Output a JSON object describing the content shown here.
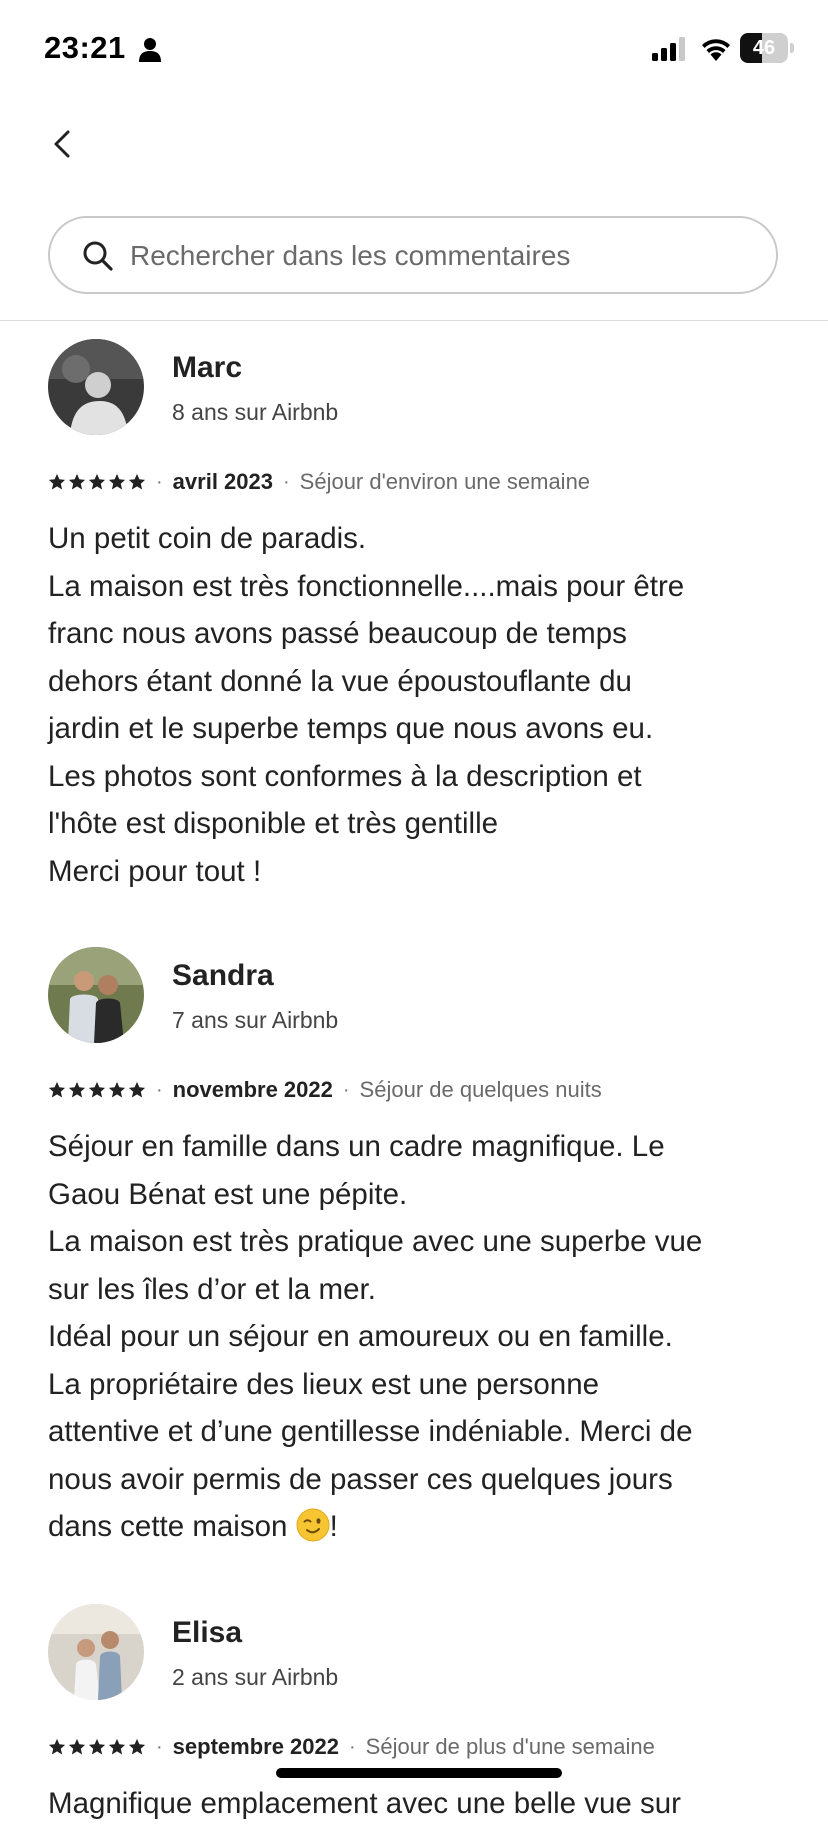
{
  "status_bar": {
    "time": "23:21",
    "battery": "46",
    "battery_level": 0.46
  },
  "search": {
    "placeholder": "Rechercher dans les commentaires"
  },
  "reviews": [
    {
      "name": "Marc",
      "tenure": "8 ans sur Airbnb",
      "rating": 5,
      "date": "avril 2023",
      "stay": "Séjour d'environ une semaine",
      "lines": [
        "Un petit coin de paradis.",
        "La maison est très fonctionnelle....mais pour être",
        "franc nous avons passé beaucoup de temps",
        "dehors étant donné la vue époustouflante du",
        "jardin et le superbe temps que nous avons eu.",
        "Les photos sont conformes à la description et",
        "l'hôte est disponible et très gentille",
        "Merci pour tout !"
      ]
    },
    {
      "name": "Sandra",
      "tenure": "7 ans sur Airbnb",
      "rating": 5,
      "date": "novembre 2022",
      "stay": "Séjour de quelques nuits",
      "lines": [
        "Séjour en famille dans un cadre magnifique. Le",
        "Gaou Bénat est une pépite.",
        "La maison est très pratique avec une superbe vue",
        "sur les îles d’or et la mer.",
        "Idéal pour un séjour en amoureux ou en famille.",
        "La propriétaire des lieux est une personne",
        "attentive et d’une gentillesse indéniable. Merci de",
        "nous avoir permis de passer ces quelques jours",
        "dans cette maison",
        "!"
      ]
    },
    {
      "name": "Elisa",
      "tenure": "2 ans sur Airbnb",
      "rating": 5,
      "date": "septembre 2022",
      "stay": "Séjour de plus d'une semaine",
      "lines": [
        "Magnifique emplacement avec une belle vue sur"
      ]
    }
  ],
  "meta_separator": "·"
}
